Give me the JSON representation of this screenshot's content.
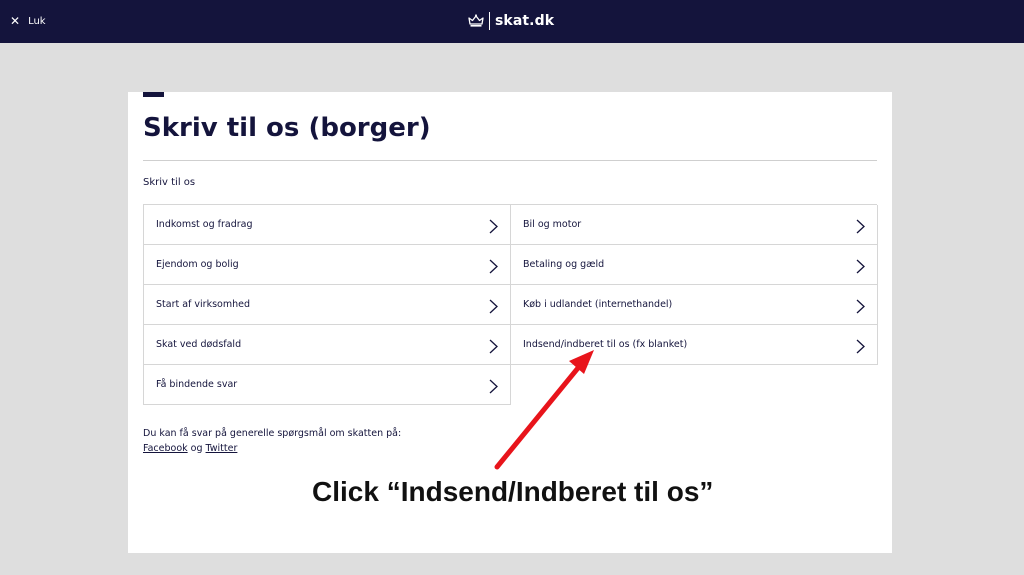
{
  "header": {
    "close_label": "Luk",
    "logo_text": "skat.dk",
    "icons": {
      "close": "close-icon",
      "logo": "crown-icon"
    },
    "background": "#14143c"
  },
  "page": {
    "title": "Skriv til os (borger)",
    "subtitle": "Skriv til os",
    "topics": [
      {
        "label": "Indkomst og fradrag"
      },
      {
        "label": "Bil og motor"
      },
      {
        "label": "Ejendom og bolig"
      },
      {
        "label": "Betaling og gæld"
      },
      {
        "label": "Start af virksomhed"
      },
      {
        "label": "Køb i udlandet (internethandel)"
      },
      {
        "label": "Skat ved dødsfald"
      },
      {
        "label": "Indsend/indberet til os (fx blanket)"
      },
      {
        "label": "Få bindende svar"
      }
    ],
    "footer": {
      "text": "Du kan få svar på generelle spørgsmål om skatten på:",
      "facebook": "Facebook",
      "conjunction": "og",
      "twitter": "Twitter"
    }
  },
  "annotation": {
    "text": "Click “Indsend/Indberet til os”",
    "arrow_color": "#e8141b"
  },
  "colors": {
    "brand_dark": "#14143c",
    "page_bg": "#dedede",
    "card_bg": "#ffffff"
  }
}
